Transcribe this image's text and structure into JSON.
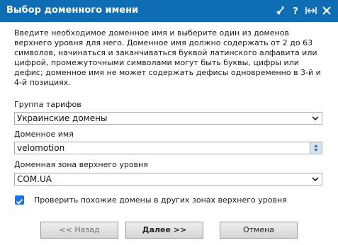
{
  "window": {
    "title": "Выбор доменного имени"
  },
  "description": "Введите необходимое доменное имя и выберите один из доменов верхнего уровня для него. Доменное имя должно содержать от 2 до 63 символов, начинаться и заканчиваться буквой латинского алфавита или цифрой, промежуточными символами могут быть буквы, цифры или дефис; доменное имя не может содержать дефисы одновременно в 3-й и 4-й позициях.",
  "tariff_group": {
    "label": "Группа тарифов",
    "value": "Украинские домены"
  },
  "domain_name": {
    "label": "Доменное имя",
    "value": "velomotion"
  },
  "tld_zone": {
    "label": "Доменная зона верхнего уровня",
    "value": "COM.UA"
  },
  "check_similar": {
    "label": "Проверить похожие домены в других зонах верхнего уровня",
    "checked": true
  },
  "buttons": {
    "back": "<< Назад",
    "next": "Далее >>",
    "cancel": "Отмена"
  },
  "colors": {
    "titlebar": "#0e6db3",
    "checkbox": "#1a73e8"
  },
  "icons": [
    "broom-icon",
    "help-icon",
    "resize-icon",
    "close-icon"
  ]
}
